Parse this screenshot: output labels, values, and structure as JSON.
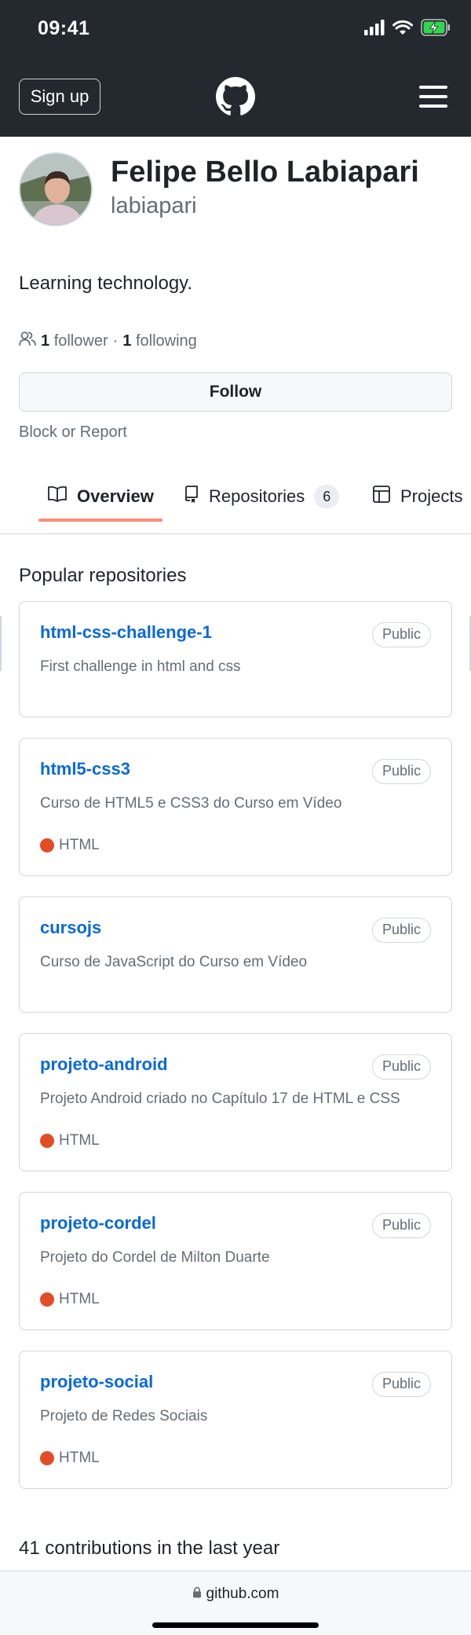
{
  "status_bar": {
    "time": "09:41",
    "icons": [
      "signal-icon",
      "wifi-icon",
      "battery-charging-icon"
    ]
  },
  "header": {
    "signup_label": "Sign up",
    "logo_icon": "github-logo-icon",
    "menu_icon": "hamburger-menu-icon"
  },
  "profile": {
    "full_name": "Felipe Bello Labiapari",
    "username": "labiapari",
    "bio": "Learning technology.",
    "followers_count": "1",
    "followers_label": "follower",
    "separator": "·",
    "following_count": "1",
    "following_label": "following",
    "follow_button": "Follow",
    "block_report": "Block or Report"
  },
  "tabs": [
    {
      "label": "Overview",
      "icon": "book-icon",
      "active": true
    },
    {
      "label": "Repositories",
      "icon": "repo-icon",
      "count": "6"
    },
    {
      "label": "Projects",
      "icon": "table-icon"
    }
  ],
  "popular": {
    "title": "Popular repositories",
    "repos": [
      {
        "name": "html-css-challenge-1",
        "visibility": "Public",
        "description": "First challenge in html and css",
        "language": ""
      },
      {
        "name": "html5-css3",
        "visibility": "Public",
        "description": "Curso de HTML5 e CSS3 do Curso em Vídeo",
        "language": "HTML"
      },
      {
        "name": "cursojs",
        "visibility": "Public",
        "description": "Curso de JavaScript do Curso em Vídeo",
        "language": ""
      },
      {
        "name": "projeto-android",
        "visibility": "Public",
        "description": "Projeto Android criado no Capítulo 17 de HTML e CSS",
        "language": "HTML"
      },
      {
        "name": "projeto-cordel",
        "visibility": "Public",
        "description": "Projeto do Cordel de Milton Duarte",
        "language": "HTML"
      },
      {
        "name": "projeto-social",
        "visibility": "Public",
        "description": "Projeto de Redes Sociais",
        "language": "HTML"
      }
    ]
  },
  "contributions": "41 contributions in the last year",
  "browser": {
    "url": "github.com",
    "lock_icon": "lock-icon"
  },
  "colors": {
    "header_bg": "#24292f",
    "link": "#0969da",
    "tab_underline": "#fd8c73",
    "html_language": "#e34c26"
  }
}
